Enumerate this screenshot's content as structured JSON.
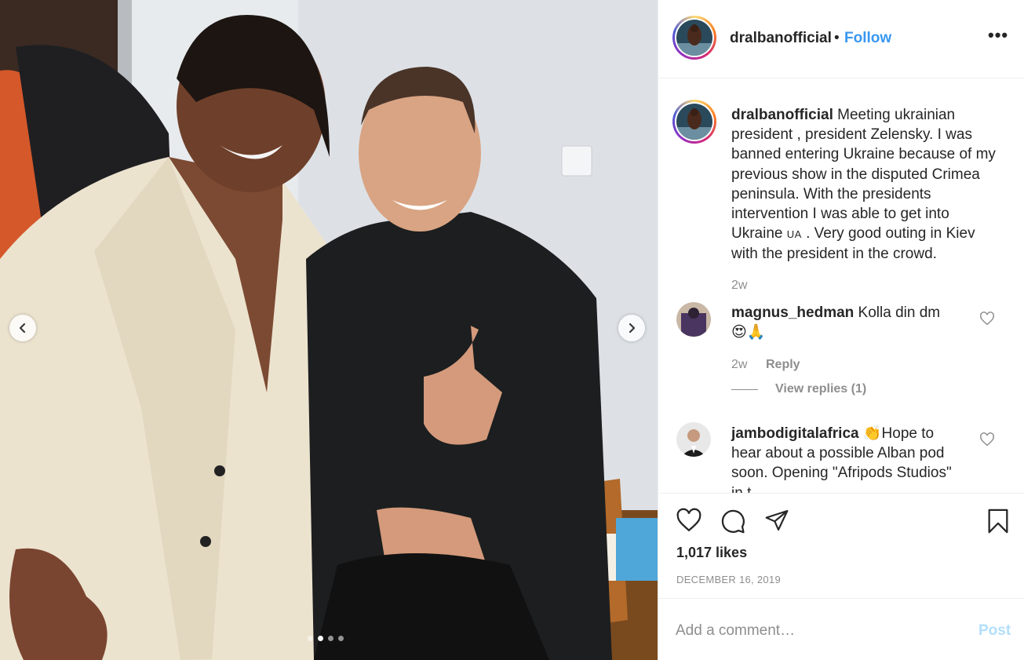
{
  "post": {
    "image": {
      "carousel_dots": 4,
      "active_dot": 2,
      "prev_icon": "chevron-left-icon",
      "next_icon": "chevron-right-icon"
    },
    "header": {
      "username": "dralbanofficial",
      "separator": "•",
      "follow_label": "Follow",
      "more_label": "•••"
    },
    "caption": {
      "username": "dralbanofficial",
      "text_before_flag": "Meeting ukrainian president , president Zelensky. I was banned entering Ukraine because of my previous show in the disputed Crimea peninsula. With the presidents intervention I was able to get into Ukraine",
      "flag": "UA",
      "text_after_flag": ". Very good outing in Kiev with the president in the crowd.",
      "time": "2w"
    },
    "comments": [
      {
        "username": "magnus_hedman",
        "text": "Kolla din dm",
        "emojis": "😍🙏",
        "time": "2w",
        "reply_label": "Reply",
        "view_replies_label": "View replies (1)"
      },
      {
        "username": "jambodigitalafrica",
        "text": "👏Hope to hear about a possible Alban pod soon. Opening \"Afripods Studios\" in t",
        "time": "",
        "reply_label": ""
      }
    ],
    "actions": {
      "like_icon": "heart-icon",
      "comment_icon": "comment-icon",
      "share_icon": "paper-plane-icon",
      "save_icon": "bookmark-icon"
    },
    "likes": "1,017 likes",
    "date": "DECEMBER 16, 2019",
    "add_comment": {
      "placeholder": "Add a comment…",
      "post_label": "Post"
    },
    "colors": {
      "link_blue": "#3897f0",
      "post_disabled": "#b2dffc",
      "secondary_text": "#8e8e8e",
      "primary_text": "#262626"
    }
  }
}
